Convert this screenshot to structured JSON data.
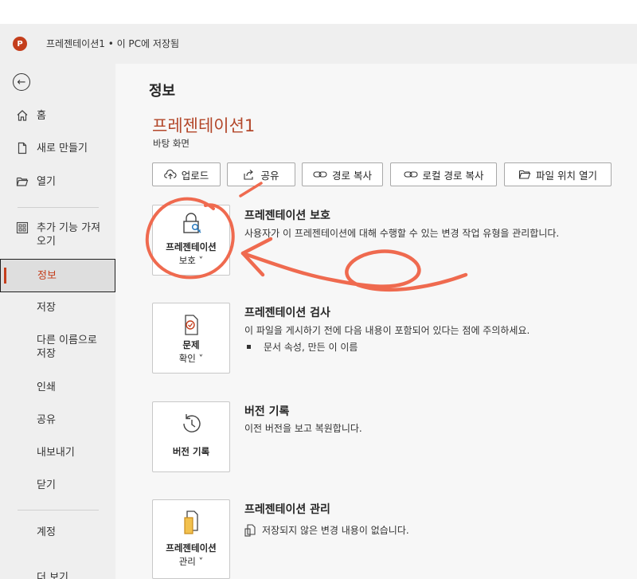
{
  "window": {
    "app_icon_letter": "P",
    "title": "프레젠테이션1 • 이 PC에 저장됨"
  },
  "sidebar": {
    "back_label": "←",
    "items": [
      {
        "label": "홈",
        "icon": "home-icon"
      },
      {
        "label": "새로 만들기",
        "icon": "new-document-icon"
      },
      {
        "label": "열기",
        "icon": "open-folder-icon"
      },
      {
        "label": "추가 기능 가져\n오기",
        "icon": "add-ins-icon"
      },
      {
        "label": "정보",
        "selected": true
      },
      {
        "label": "저장"
      },
      {
        "label": "다른 이름으로\n저장"
      },
      {
        "label": "인쇄"
      },
      {
        "label": "공유"
      },
      {
        "label": "내보내기"
      },
      {
        "label": "닫기"
      },
      {
        "label": "계정"
      },
      {
        "label": "더 보기"
      }
    ]
  },
  "main": {
    "page_title": "정보",
    "presentation_name": "프레젠테이션1",
    "location": "바탕 화면",
    "actions": [
      {
        "label": "업로드",
        "icon": "upload-icon"
      },
      {
        "label": "공유",
        "icon": "share-icon"
      },
      {
        "label": "경로 복사",
        "icon": "link-icon"
      },
      {
        "label": "로컬 경로 복사",
        "icon": "link-icon"
      },
      {
        "label": "파일 위치 열기",
        "icon": "folder-icon"
      }
    ],
    "sections": [
      {
        "card_label_1": "프레젠테이션",
        "card_label_2": "보호 ˅",
        "title": "프레젠테이션 보호",
        "description": "사용자가 이 프레젠테이션에 대해 수행할 수 있는 변경 작업 유형을 관리합니다."
      },
      {
        "card_label_1": "문제",
        "card_label_2": "확인 ˅",
        "title": "프레젠테이션 검사",
        "description": "이 파일을 게시하기 전에 다음 내용이 포함되어 있다는 점에 주의하세요.",
        "bullet": "문서 속성, 만든 이 이름"
      },
      {
        "card_label_1": "버전 기록",
        "title": "버전 기록",
        "description": "이전 버전을 보고 복원합니다."
      },
      {
        "card_label_1": "프레젠테이션",
        "card_label_2": "관리 ˅",
        "title": "프레젠테이션 관리",
        "description": "저장되지 않은 변경 내용이 없습니다."
      }
    ]
  },
  "colors": {
    "accent": "#c43e1c",
    "title_accent": "#b3472a",
    "annotation": "#ef6a4f"
  }
}
